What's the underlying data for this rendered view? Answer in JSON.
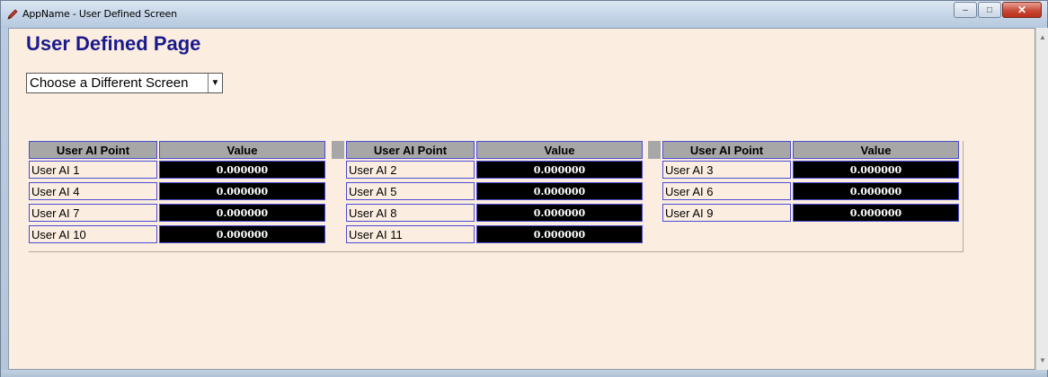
{
  "window": {
    "title": "AppName - User Defined Screen",
    "controls": {
      "minimize": "–",
      "maximize": "□",
      "close": "✕"
    }
  },
  "page": {
    "title": "User Defined Page",
    "screen_select": {
      "value": "Choose a Different Screen"
    }
  },
  "tables": [
    {
      "headers": {
        "point": "User AI Point",
        "value": "Value"
      },
      "rows": [
        {
          "label": "User AI 1",
          "value": "0.000000"
        },
        {
          "label": "User AI 4",
          "value": "0.000000"
        },
        {
          "label": "User AI 7",
          "value": "0.000000"
        },
        {
          "label": "User AI 10",
          "value": "0.000000"
        }
      ]
    },
    {
      "headers": {
        "point": "User AI Point",
        "value": "Value"
      },
      "rows": [
        {
          "label": "User AI 2",
          "value": "0.000000"
        },
        {
          "label": "User AI 5",
          "value": "0.000000"
        },
        {
          "label": "User AI 8",
          "value": "0.000000"
        },
        {
          "label": "User AI 11",
          "value": "0.000000"
        }
      ]
    },
    {
      "headers": {
        "point": "User AI Point",
        "value": "Value"
      },
      "rows": [
        {
          "label": "User AI 3",
          "value": "0.000000"
        },
        {
          "label": "User AI 6",
          "value": "0.000000"
        },
        {
          "label": "User AI 9",
          "value": "0.000000"
        }
      ]
    }
  ],
  "icons": {
    "app": "pen-icon",
    "scroll_up": "chevron-up-icon",
    "scroll_down": "chevron-down-icon"
  },
  "colors": {
    "page_bg": "#fbeee0",
    "title": "#1a1a8c",
    "header_bg": "#a7a7a7",
    "cell_border": "#4b4bd1",
    "value_bg": "#000000"
  }
}
